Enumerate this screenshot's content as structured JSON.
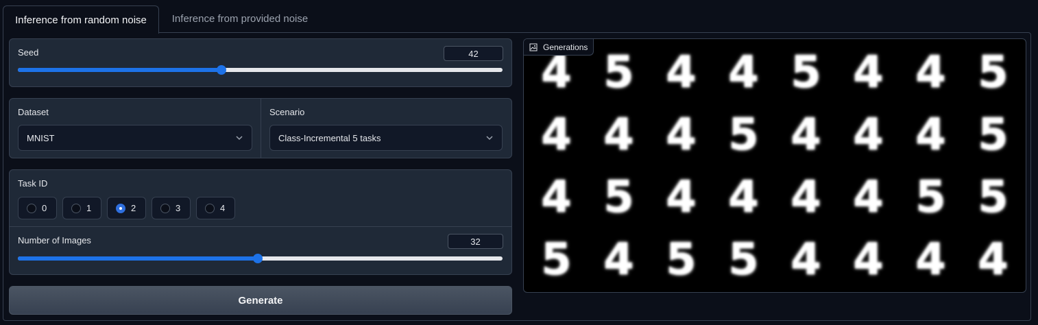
{
  "tabs": [
    {
      "label": "Inference from random noise",
      "active": true
    },
    {
      "label": "Inference from provided noise",
      "active": false
    }
  ],
  "seed": {
    "label": "Seed",
    "value": "42",
    "fraction": 0.42
  },
  "dataset": {
    "label": "Dataset",
    "value": "MNIST"
  },
  "scenario": {
    "label": "Scenario",
    "value": "Class-Incremental 5 tasks"
  },
  "task_id": {
    "label": "Task ID",
    "options": [
      "0",
      "1",
      "2",
      "3",
      "4"
    ],
    "selected": "2"
  },
  "num_images": {
    "label": "Number of Images",
    "value": "32",
    "fraction": 0.495
  },
  "generate_button": {
    "label": "Generate"
  },
  "gallery": {
    "label": "Generations",
    "digits": [
      "4",
      "5",
      "4",
      "4",
      "5",
      "4",
      "4",
      "5",
      "4",
      "4",
      "4",
      "5",
      "4",
      "4",
      "4",
      "5",
      "4",
      "5",
      "4",
      "4",
      "4",
      "4",
      "5",
      "5",
      "5",
      "4",
      "5",
      "5",
      "4",
      "4",
      "4",
      "4"
    ]
  },
  "colors": {
    "accent": "#1d72e8",
    "background": "#0b0f19",
    "block": "#1f2937"
  }
}
